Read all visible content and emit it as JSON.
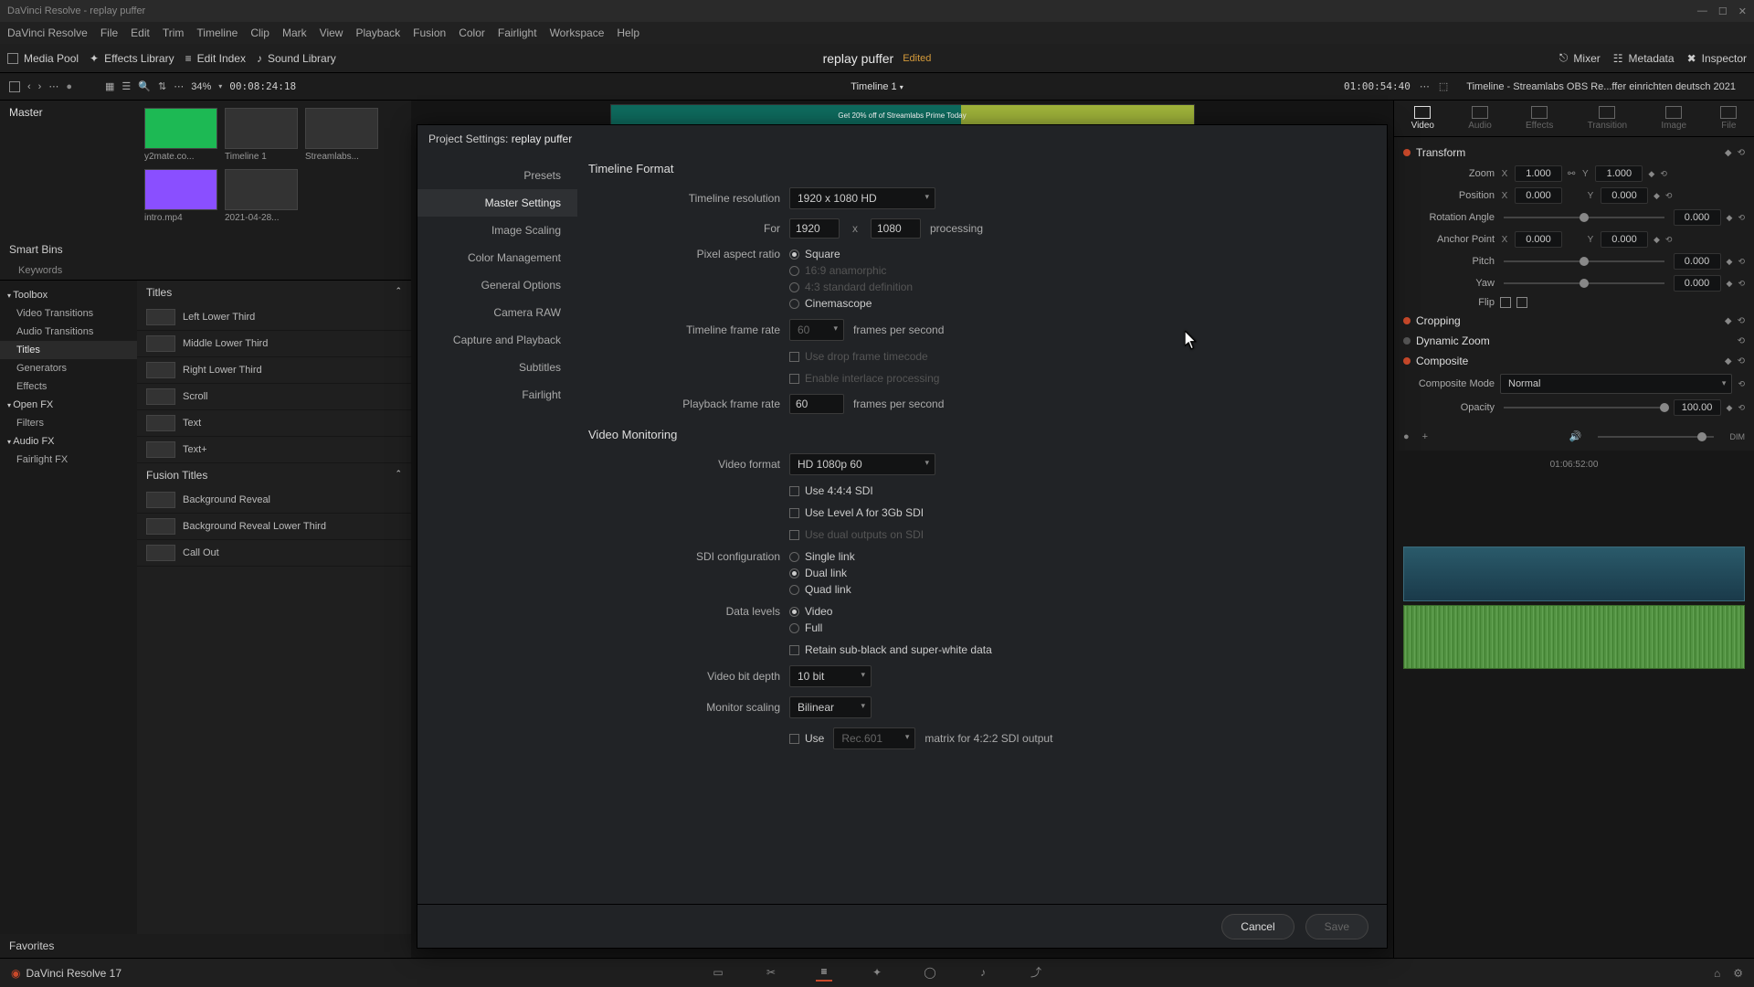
{
  "titlebar": {
    "text": "DaVinci Resolve - replay puffer"
  },
  "menubar": [
    "DaVinci Resolve",
    "File",
    "Edit",
    "Trim",
    "Timeline",
    "Clip",
    "Mark",
    "View",
    "Playback",
    "Fusion",
    "Color",
    "Fairlight",
    "Workspace",
    "Help"
  ],
  "toolbar": {
    "media_pool": "Media Pool",
    "effects_library": "Effects Library",
    "edit_index": "Edit Index",
    "sound_library": "Sound Library",
    "project_name": "replay puffer",
    "edited": "Edited",
    "mixer": "Mixer",
    "metadata": "Metadata",
    "inspector": "Inspector"
  },
  "subtoolbar": {
    "zoom": "34%",
    "timecode_left": "00:08:24:18",
    "timeline_name": "Timeline 1",
    "timecode_right": "01:00:54:40",
    "inspector_title": "Timeline - Streamlabs OBS Re...ffer einrichten deutsch 2021"
  },
  "media": {
    "bin": "Master",
    "clips": [
      {
        "label": "y2mate.co...",
        "cls": "green"
      },
      {
        "label": "Timeline 1",
        "cls": ""
      },
      {
        "label": "Streamlabs...",
        "cls": ""
      },
      {
        "label": "intro.mp4",
        "cls": "purple"
      },
      {
        "label": "2021-04-28...",
        "cls": ""
      }
    ],
    "smart_bins_hdr": "Smart Bins",
    "keywords": "Keywords"
  },
  "toolbox": {
    "items": [
      {
        "label": "Toolbox",
        "root": true
      },
      {
        "label": "Video Transitions"
      },
      {
        "label": "Audio Transitions"
      },
      {
        "label": "Titles",
        "selected": true
      },
      {
        "label": "Generators"
      },
      {
        "label": "Effects"
      },
      {
        "label": "Open FX",
        "root": true
      },
      {
        "label": "Filters"
      },
      {
        "label": "Audio FX",
        "root": true
      },
      {
        "label": "Fairlight FX"
      }
    ]
  },
  "titles": {
    "hdr": "Titles",
    "items": [
      "Left Lower Third",
      "Middle Lower Third",
      "Right Lower Third",
      "Scroll",
      "Text",
      "Text+"
    ],
    "fusion_hdr": "Fusion Titles",
    "fusion_items": [
      "Background Reveal",
      "Background Reveal Lower Third",
      "Call Out"
    ]
  },
  "favorites": "Favorites",
  "viewer_strip": "Get 20% off of Streamlabs Prime Today",
  "modal": {
    "title_prefix": "Project Settings:",
    "project": "replay puffer",
    "sidebar": [
      "Presets",
      "Master Settings",
      "Image Scaling",
      "Color Management",
      "General Options",
      "Camera RAW",
      "Capture and Playback",
      "Subtitles",
      "Fairlight"
    ],
    "sidebar_active": 1,
    "sections": {
      "timeline_format": "Timeline Format",
      "video_monitoring": "Video Monitoring"
    },
    "fields": {
      "timeline_resolution_label": "Timeline resolution",
      "timeline_resolution_value": "1920 x 1080 HD",
      "for_label": "For",
      "for_w": "1920",
      "for_x": "x",
      "for_h": "1080",
      "processing": "processing",
      "pixel_aspect_label": "Pixel aspect ratio",
      "par_options": [
        {
          "label": "Square",
          "on": true
        },
        {
          "label": "16:9 anamorphic",
          "disabled": true
        },
        {
          "label": "4:3 standard definition",
          "disabled": true
        },
        {
          "label": "Cinemascope"
        }
      ],
      "timeline_fps_label": "Timeline frame rate",
      "timeline_fps_value": "60",
      "fps_suffix": "frames per second",
      "drop_frame": "Use drop frame timecode",
      "interlace": "Enable interlace processing",
      "playback_fps_label": "Playback frame rate",
      "playback_fps_value": "60",
      "video_format_label": "Video format",
      "video_format_value": "HD 1080p 60",
      "use_444": "Use 4:4:4 SDI",
      "level_a": "Use Level A for 3Gb SDI",
      "dual_outputs": "Use dual outputs on SDI",
      "sdi_config_label": "SDI configuration",
      "sdi_options": [
        {
          "label": "Single link"
        },
        {
          "label": "Dual link",
          "on": true
        },
        {
          "label": "Quad link"
        }
      ],
      "data_levels_label": "Data levels",
      "data_levels_options": [
        {
          "label": "Video",
          "on": true
        },
        {
          "label": "Full"
        }
      ],
      "retain": "Retain sub-black and super-white data",
      "bit_depth_label": "Video bit depth",
      "bit_depth_value": "10 bit",
      "monitor_scaling_label": "Monitor scaling",
      "monitor_scaling_value": "Bilinear",
      "use_matrix_prefix": "Use",
      "use_matrix_value": "Rec.601",
      "use_matrix_suffix": "matrix for 4:2:2 SDI output"
    },
    "cancel": "Cancel",
    "save": "Save"
  },
  "inspector": {
    "tabs": [
      "Video",
      "Audio",
      "Effects",
      "Transition",
      "Image",
      "File"
    ],
    "tab_active": 0,
    "transform": {
      "hdr": "Transform",
      "zoom_label": "Zoom",
      "zoom_x": "1.000",
      "zoom_y": "1.000",
      "position_label": "Position",
      "pos_x": "0.000",
      "pos_y": "0.000",
      "rotation_label": "Rotation Angle",
      "rotation": "0.000",
      "anchor_label": "Anchor Point",
      "anchor_x": "0.000",
      "anchor_y": "0.000",
      "pitch_label": "Pitch",
      "pitch": "0.000",
      "yaw_label": "Yaw",
      "yaw": "0.000",
      "flip_label": "Flip"
    },
    "cropping": "Cropping",
    "dynamic_zoom": "Dynamic Zoom",
    "composite": "Composite",
    "composite_mode_label": "Composite Mode",
    "composite_mode_value": "Normal",
    "opacity_label": "Opacity",
    "opacity_value": "100.00",
    "tl_time": "01:06:52:00"
  },
  "bottombar": {
    "app": "DaVinci Resolve 17"
  }
}
